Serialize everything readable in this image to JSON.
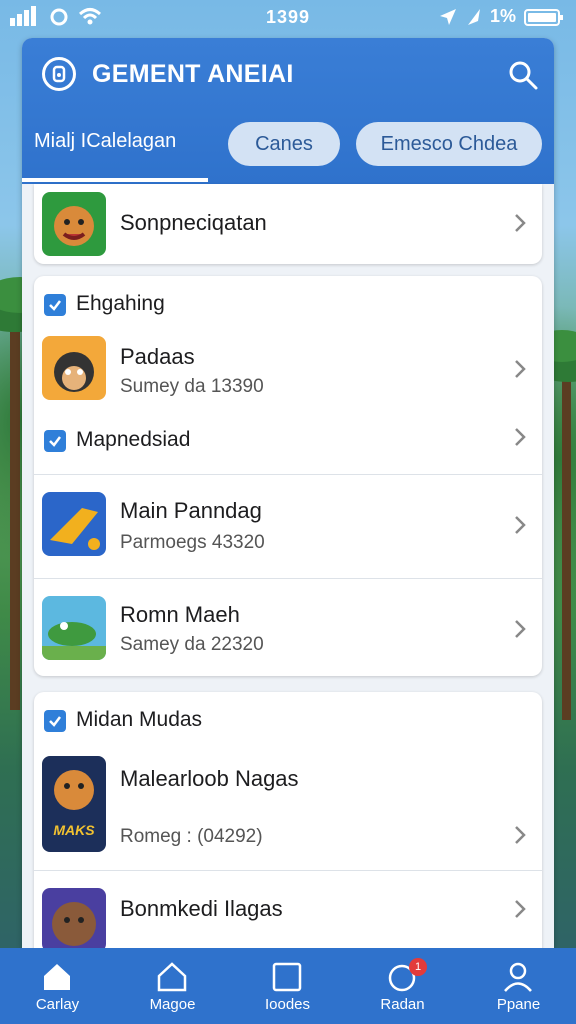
{
  "status_bar": {
    "time": "1399",
    "battery": "1%"
  },
  "header": {
    "app_title": "GEMENT ANEIAI",
    "tabs": [
      {
        "label": "Mialj ICalelagan"
      },
      {
        "label": "Canes"
      },
      {
        "label": "Emesco Chdea"
      }
    ]
  },
  "list": {
    "top_item": {
      "title": "Sonpneciqatan"
    },
    "group1": {
      "label": "Ehgahing",
      "item1": {
        "title": "Padaas",
        "subtitle": "Sumey da 13390"
      },
      "sublabel": "Mapnedsiad",
      "item2": {
        "title": "Main Panndag",
        "subtitle": "Parmoegs 43320"
      },
      "item3": {
        "title": "Romn Maeh",
        "subtitle": "Samey da 22320"
      }
    },
    "group2": {
      "label": "Midan Mudas",
      "item1": {
        "title": "Malearloob Nagas",
        "subtitle": "Romeg : (04292)",
        "thumb_text": "MAKS"
      },
      "item2": {
        "title": "Bonmkedi Ilagas"
      }
    }
  },
  "bottom_nav": {
    "items": [
      {
        "label": "Carlay",
        "icon": "home-icon"
      },
      {
        "label": "Magoe",
        "icon": "house-outline-icon"
      },
      {
        "label": "Ioodes",
        "icon": "square-icon"
      },
      {
        "label": "Radan",
        "icon": "circle-icon",
        "badge": "1"
      },
      {
        "label": "Ppane",
        "icon": "person-icon"
      }
    ]
  },
  "colors": {
    "accent": "#2f72cc",
    "pill_bg": "#d3e2f4",
    "checkbox": "#2f7fd9",
    "badge": "#e23b3b"
  }
}
